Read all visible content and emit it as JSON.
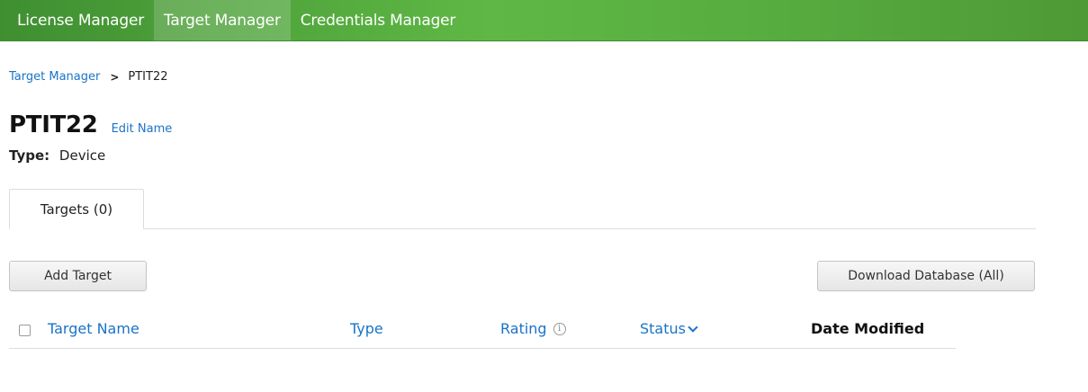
{
  "nav": {
    "items": [
      {
        "label": "License Manager"
      },
      {
        "label": "Target Manager"
      },
      {
        "label": "Credentials Manager"
      }
    ],
    "active": "Target Manager"
  },
  "breadcrumb": {
    "parent": "Target Manager",
    "separator": ">",
    "current": "PTIT22"
  },
  "header": {
    "title": "PTIT22",
    "edit_label": "Edit Name",
    "type_label": "Type:",
    "type_value": "Device"
  },
  "tabs": [
    {
      "label": "Targets (0)"
    }
  ],
  "toolbar": {
    "add_label": "Add Target",
    "download_label": "Download Database (All)"
  },
  "table": {
    "columns": [
      {
        "label": "Target Name"
      },
      {
        "label": "Type"
      },
      {
        "label": "Rating"
      },
      {
        "label": "Status"
      },
      {
        "label": "Date Modified"
      }
    ],
    "rating_icon": "info-icon",
    "status_icon": "chevron-down-icon"
  },
  "colors": {
    "nav_green": "#57ad3f",
    "link_blue": "#1a73c8"
  }
}
